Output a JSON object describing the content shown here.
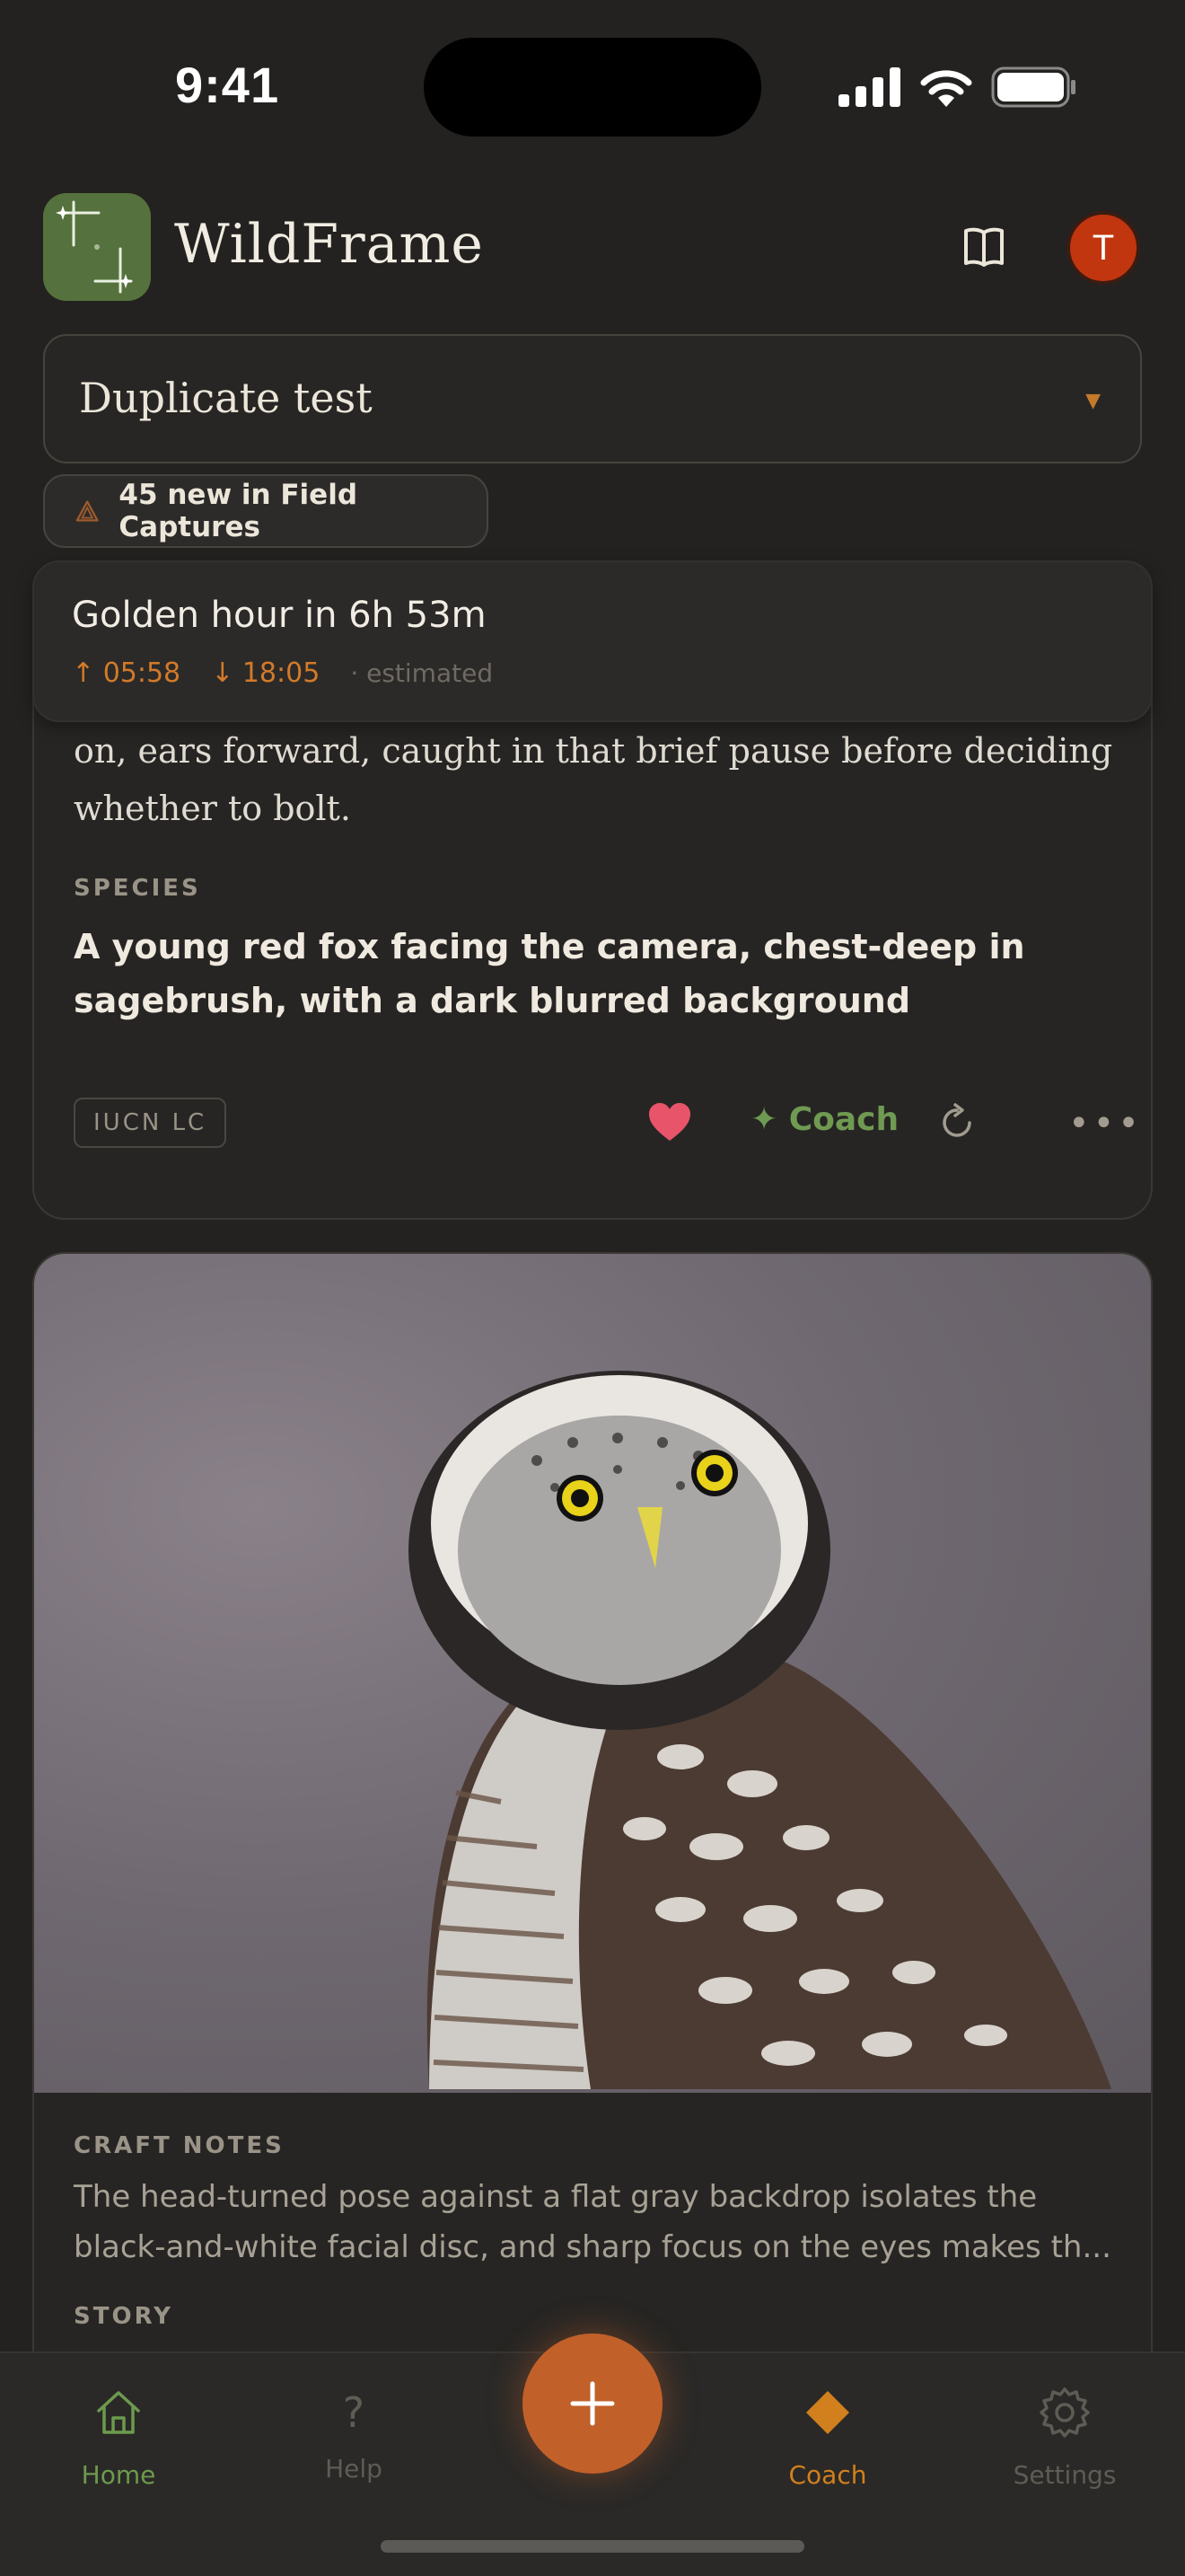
{
  "status_bar": {
    "time": "9:41"
  },
  "header": {
    "app_title": "WildFrame",
    "avatar_initial": "T"
  },
  "collection_selector": {
    "value": "Duplicate test"
  },
  "new_pill": {
    "text": "45 new in Field Captures"
  },
  "golden_hour": {
    "title": "Golden hour in 6h 53m",
    "sunrise": "05:58",
    "sunset": "18:05",
    "note": "· estimated"
  },
  "card1": {
    "story_line1": "on, ears forward, caught in that brief pause before deciding",
    "story_line2": "whether to bolt.",
    "species_label": "SPECIES",
    "species": "A young red fox facing the camera, chest-deep in sagebrush, with a dark blurred background",
    "tag": "IUCN LC",
    "coach_label": "✦ Coach"
  },
  "card2": {
    "craft_label": "CRAFT NOTES",
    "craft_text": "The head-turned pose against a flat gray backdrop isolates the black-and-white facial disc, and sharp focus on the eyes makes th...",
    "story_label": "STORY"
  },
  "tabbar": {
    "home": "Home",
    "help": "Help",
    "coach": "Coach",
    "settings": "Settings"
  },
  "colors": {
    "accent_green": "#6c9a4e",
    "accent_orange": "#d1801d",
    "fab": "#c2602a",
    "heart": "#e8546a"
  },
  "icons": [
    "signal-icon",
    "wifi-icon",
    "battery-icon",
    "book-icon",
    "warning-icon",
    "heart-icon",
    "refresh-icon",
    "more-icon",
    "home-icon",
    "help-icon",
    "coach-diamond-icon",
    "gear-icon",
    "plus-icon"
  ]
}
